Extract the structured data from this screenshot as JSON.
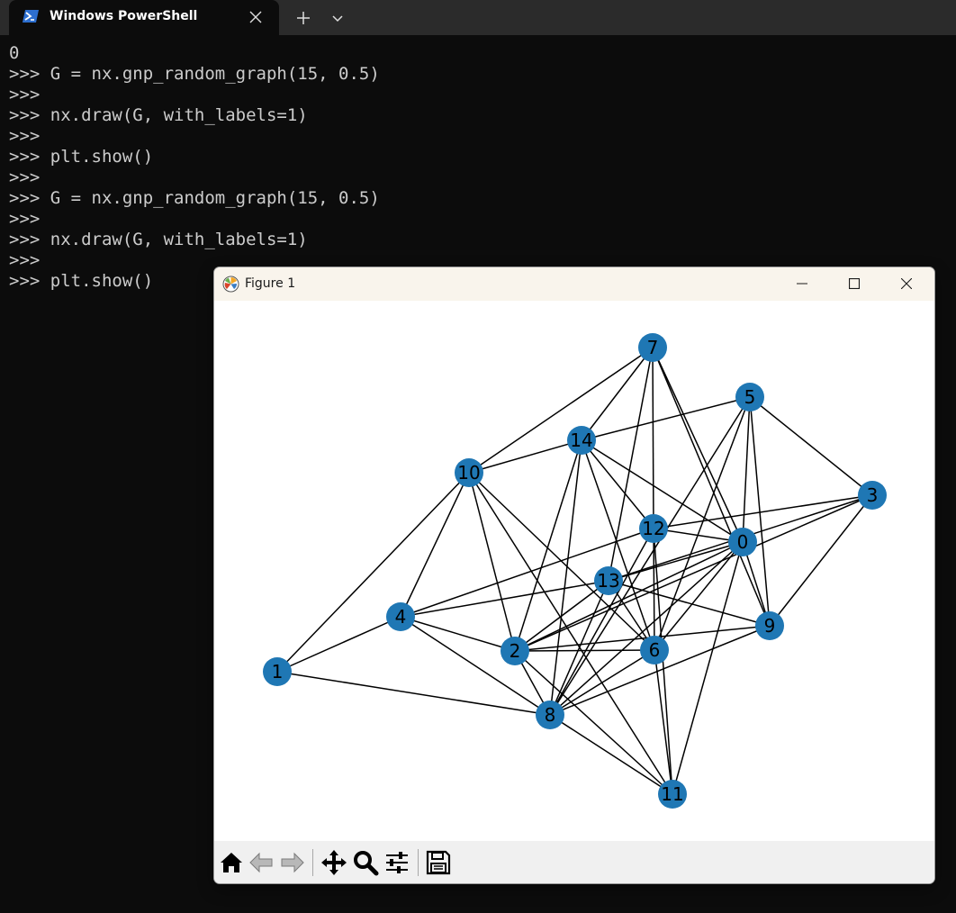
{
  "terminal": {
    "tab_title": "Windows PowerShell",
    "tab_icon": "powershell-icon",
    "lines": [
      "0",
      ">>> G = nx.gnp_random_graph(15, 0.5)",
      ">>>",
      ">>> nx.draw(G, with_labels=1)",
      ">>>",
      ">>> plt.show()",
      ">>>",
      ">>> G = nx.gnp_random_graph(15, 0.5)",
      ">>>",
      ">>> nx.draw(G, with_labels=1)",
      ">>>",
      ">>> plt.show()"
    ]
  },
  "figure_window": {
    "title": "Figure 1",
    "icon": "matplotlib-icon",
    "controls": [
      "minimize-icon",
      "maximize-icon",
      "close-icon"
    ],
    "toolbar_icons": [
      "home-icon",
      "back-arrow-icon",
      "forward-arrow-icon",
      "pan-icon",
      "zoom-icon",
      "configure-subplots-icon",
      "save-icon"
    ]
  },
  "colors": {
    "terminal_bg": "#0c0c0c",
    "terminal_text": "#cccccc",
    "tabbar_bg": "#2b2b2b",
    "node_fill": "#1f77b4",
    "edge": "#000000",
    "figure_titlebar": "#f9f4ec",
    "toolbar_bg": "#f0f0f0"
  },
  "chart_data": {
    "type": "network graph",
    "nodes": [
      "0",
      "1",
      "2",
      "3",
      "4",
      "5",
      "6",
      "7",
      "8",
      "9",
      "10",
      "11",
      "12",
      "13",
      "14"
    ],
    "edges": [
      [
        "7",
        "10"
      ],
      [
        "7",
        "14"
      ],
      [
        "7",
        "12"
      ],
      [
        "7",
        "13"
      ],
      [
        "7",
        "0"
      ],
      [
        "7",
        "9"
      ],
      [
        "5",
        "14"
      ],
      [
        "5",
        "3"
      ],
      [
        "5",
        "0"
      ],
      [
        "5",
        "9"
      ],
      [
        "5",
        "6"
      ],
      [
        "5",
        "8"
      ],
      [
        "14",
        "10"
      ],
      [
        "14",
        "0"
      ],
      [
        "14",
        "12"
      ],
      [
        "14",
        "6"
      ],
      [
        "14",
        "2"
      ],
      [
        "14",
        "8"
      ],
      [
        "10",
        "1"
      ],
      [
        "10",
        "4"
      ],
      [
        "10",
        "2"
      ],
      [
        "10",
        "6"
      ],
      [
        "10",
        "11"
      ],
      [
        "3",
        "12"
      ],
      [
        "3",
        "13"
      ],
      [
        "3",
        "9"
      ],
      [
        "3",
        "2"
      ],
      [
        "12",
        "0"
      ],
      [
        "12",
        "6"
      ],
      [
        "12",
        "11"
      ],
      [
        "12",
        "4"
      ],
      [
        "12",
        "8"
      ],
      [
        "0",
        "13"
      ],
      [
        "0",
        "9"
      ],
      [
        "0",
        "6"
      ],
      [
        "0",
        "11"
      ],
      [
        "0",
        "8"
      ],
      [
        "0",
        "2"
      ],
      [
        "13",
        "4"
      ],
      [
        "13",
        "9"
      ],
      [
        "13",
        "8"
      ],
      [
        "13",
        "2"
      ],
      [
        "13",
        "6"
      ],
      [
        "4",
        "1"
      ],
      [
        "4",
        "8"
      ],
      [
        "4",
        "2"
      ],
      [
        "1",
        "8"
      ],
      [
        "2",
        "6"
      ],
      [
        "2",
        "8"
      ],
      [
        "2",
        "11"
      ],
      [
        "2",
        "9"
      ],
      [
        "6",
        "11"
      ],
      [
        "6",
        "8"
      ],
      [
        "9",
        "8"
      ],
      [
        "8",
        "11"
      ]
    ]
  }
}
